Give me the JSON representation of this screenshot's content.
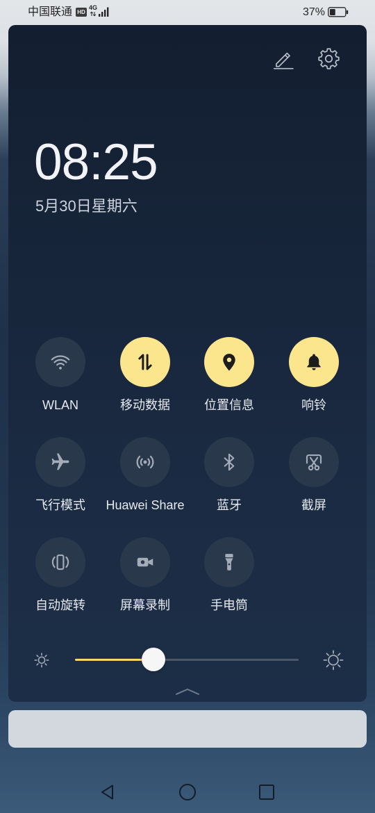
{
  "status_bar": {
    "carrier": "中国联通",
    "hd_badge": "HD",
    "network_type": "4G",
    "signal_bars": 4,
    "battery_label": "37%",
    "battery_level": 0.37
  },
  "panel": {
    "edit_icon": "edit-icon",
    "settings_icon": "gear-icon",
    "time": "08:25",
    "date": "5月30日星期六"
  },
  "tiles": [
    {
      "label": "WLAN",
      "icon": "wifi-icon",
      "active": false
    },
    {
      "label": "移动数据",
      "icon": "mobile-data-icon",
      "active": true
    },
    {
      "label": "位置信息",
      "icon": "location-pin-icon",
      "active": true
    },
    {
      "label": "响铃",
      "icon": "bell-icon",
      "active": true
    },
    {
      "label": "飞行模式",
      "icon": "airplane-icon",
      "active": false
    },
    {
      "label": "Huawei Share",
      "icon": "huawei-share-icon",
      "active": false
    },
    {
      "label": "蓝牙",
      "icon": "bluetooth-icon",
      "active": false
    },
    {
      "label": "截屏",
      "icon": "screenshot-scissors-icon",
      "active": false
    },
    {
      "label": "自动旋转",
      "icon": "auto-rotate-icon",
      "active": false
    },
    {
      "label": "屏幕录制",
      "icon": "video-camera-icon",
      "active": false
    },
    {
      "label": "手电筒",
      "icon": "flashlight-icon",
      "active": false
    }
  ],
  "brightness": {
    "level": 0.35,
    "min_icon": "sun-small-icon",
    "max_icon": "sun-large-icon"
  },
  "expand_handle": {
    "icon": "chevron-up-icon"
  },
  "nav_bar": {
    "back_icon": "back-icon",
    "home_icon": "home-icon",
    "recents_icon": "recents-icon"
  },
  "colors": {
    "accent": "#fbe58d",
    "tile_inactive": "#2a384b",
    "icon_inactive": "#a3acb8",
    "icon_active": "#1c1c1c",
    "slider_fill": "#f4d86e",
    "slider_track": "#4c5869",
    "card": "#d3d8de",
    "nav_icon": "#141d27"
  }
}
